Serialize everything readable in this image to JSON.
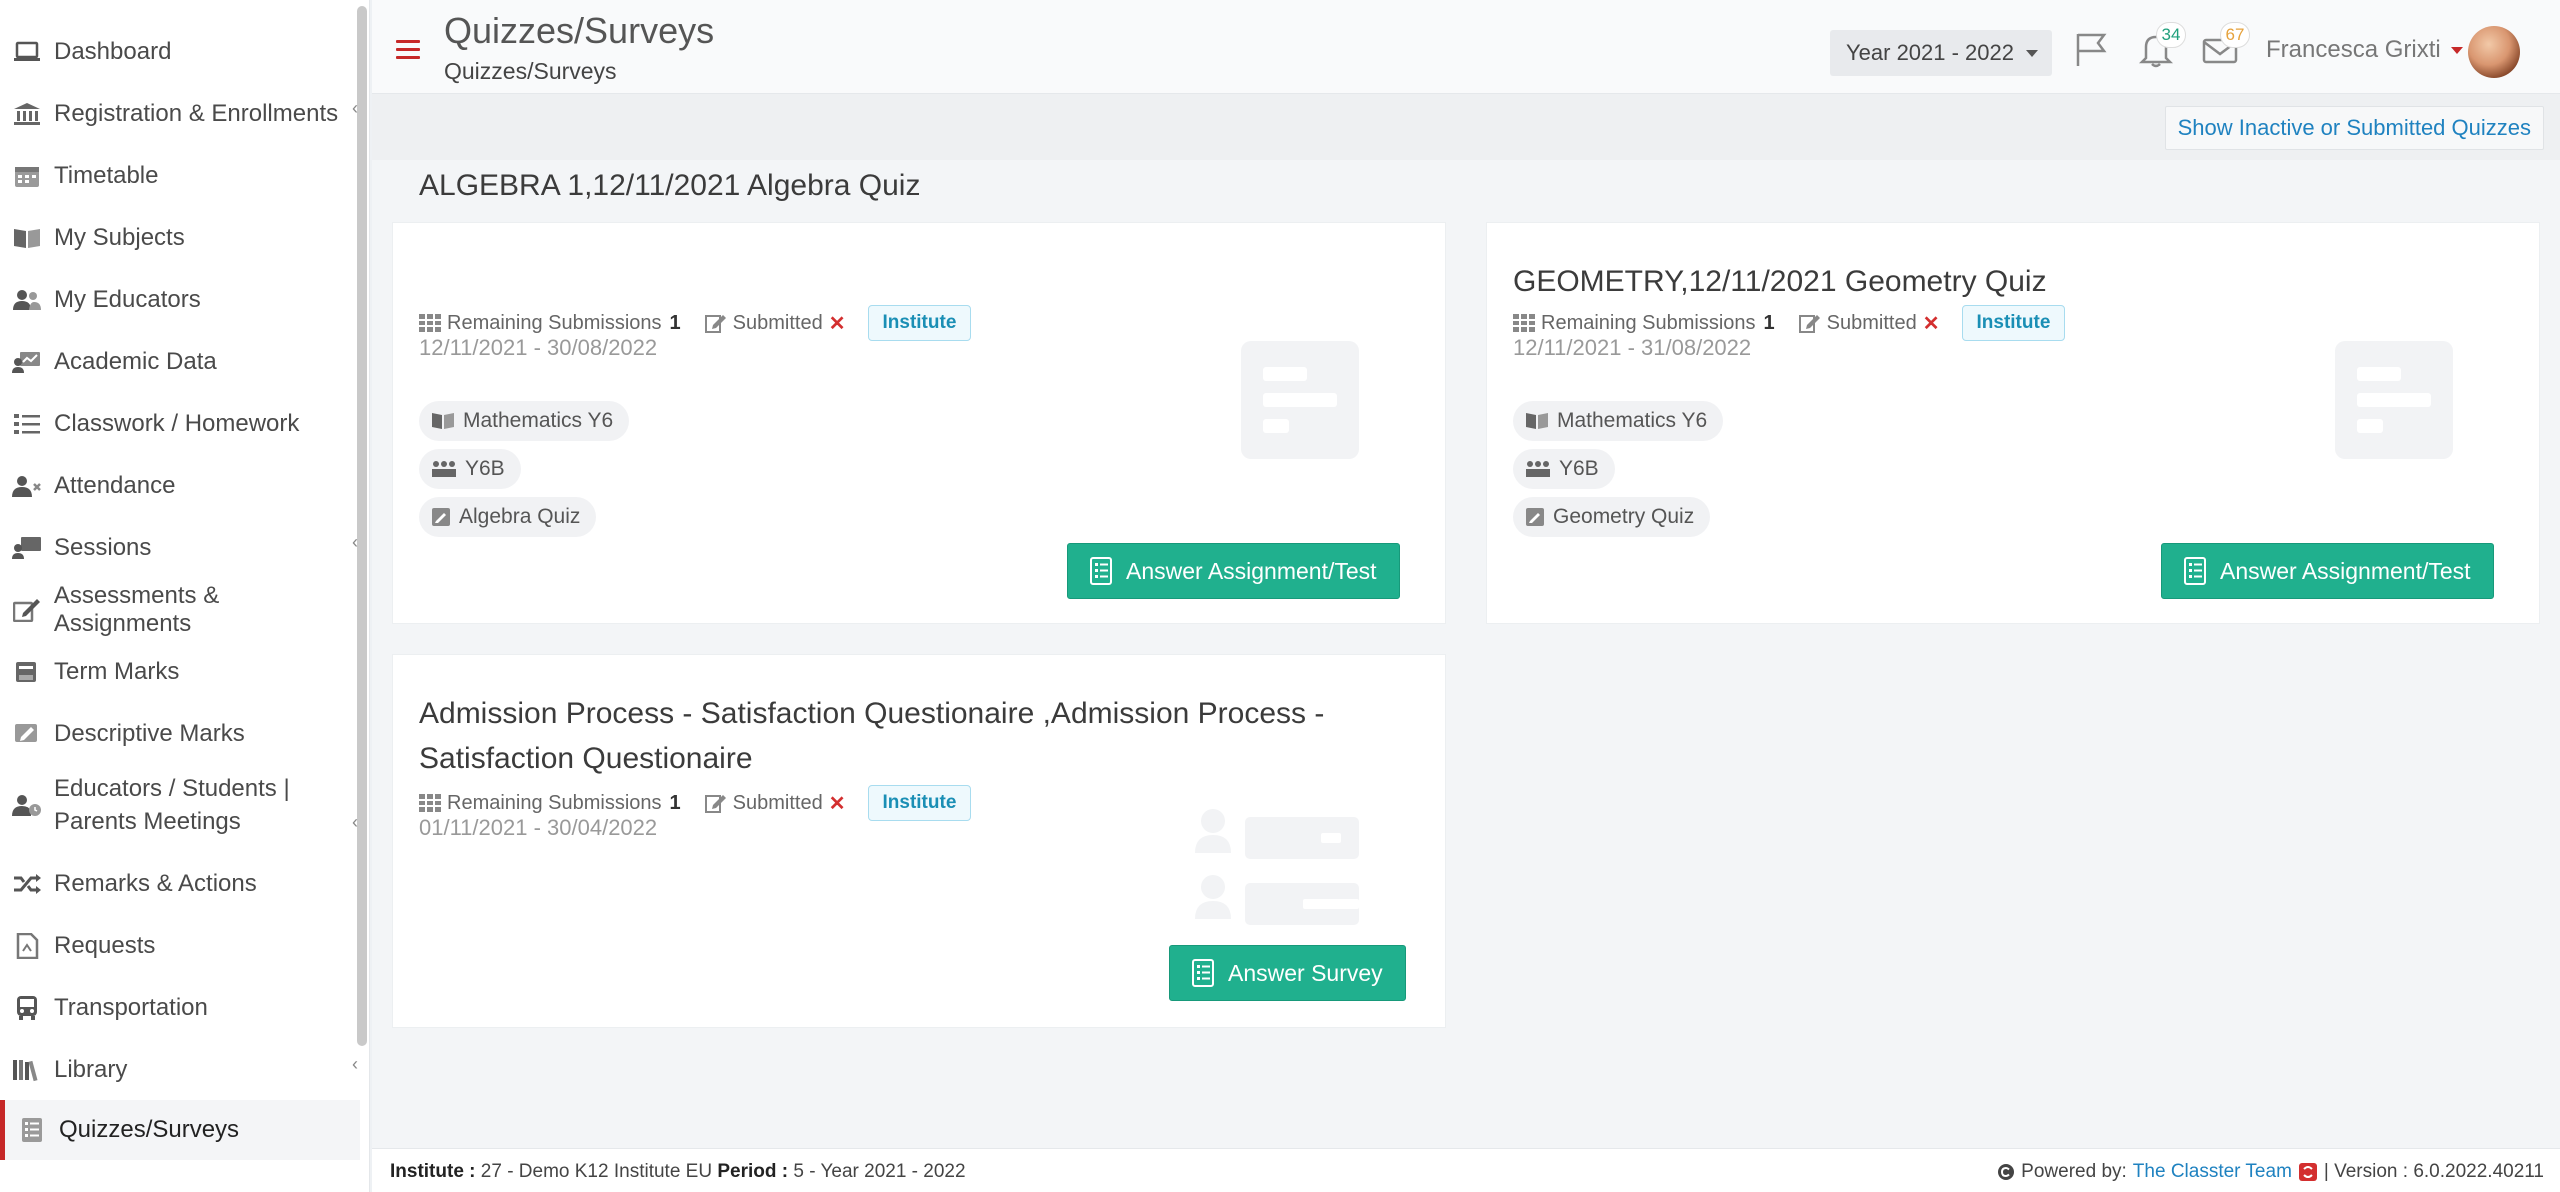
{
  "sidebar": {
    "items": [
      {
        "label": "Dashboard",
        "icon": "laptop-icon",
        "chevron": false
      },
      {
        "label": "Registration & Enrollments",
        "icon": "bank-icon",
        "chevron": true
      },
      {
        "label": "Timetable",
        "icon": "calendar-icon",
        "chevron": false
      },
      {
        "label": "My Subjects",
        "icon": "book-icon",
        "chevron": false
      },
      {
        "label": "My Educators",
        "icon": "users-icon",
        "chevron": false
      },
      {
        "label": "Academic Data",
        "icon": "chart-icon",
        "chevron": false
      },
      {
        "label": "Classwork / Homework",
        "icon": "checklist-icon",
        "chevron": false
      },
      {
        "label": "Attendance",
        "icon": "user-x-icon",
        "chevron": false
      },
      {
        "label": "Sessions",
        "icon": "presentation-icon",
        "chevron": true
      },
      {
        "label": "Assessments & Assignments",
        "icon": "edit-icon",
        "chevron": false
      },
      {
        "label": "Term Marks",
        "icon": "books-icon",
        "chevron": false
      },
      {
        "label": "Descriptive Marks",
        "icon": "comment-edit-icon",
        "chevron": false
      },
      {
        "label": "Educators / Students | Parents Meetings",
        "icon": "user-clock-icon",
        "chevron": true
      },
      {
        "label": "Remarks & Actions",
        "icon": "shuffle-icon",
        "chevron": false
      },
      {
        "label": "Requests",
        "icon": "document-icon",
        "chevron": false
      },
      {
        "label": "Transportation",
        "icon": "bus-icon",
        "chevron": false
      },
      {
        "label": "Library",
        "icon": "library-icon",
        "chevron": true
      },
      {
        "label": "Quizzes/Surveys",
        "icon": "quiz-icon",
        "chevron": false,
        "active": true
      }
    ]
  },
  "header": {
    "title": "Quizzes/Surveys",
    "subtitle": "Quizzes/Surveys",
    "year": "Year 2021 - 2022",
    "notifications_count": "34",
    "messages_count": "67",
    "user_name": "Francesca Grixti"
  },
  "toolbar": {
    "show_inactive_label": "Show Inactive or Submitted Quizzes"
  },
  "cards": [
    {
      "title": "ALGEBRA 1,12/11/2021 Algebra Quiz",
      "remaining_label": "Remaining Submissions",
      "remaining_value": "1",
      "submitted_label": "Submitted",
      "submitted_mark": "✕",
      "badge": "Institute",
      "dates": "12/11/2021 - 30/08/2022",
      "tags": [
        "Mathematics Y6",
        "Y6B",
        "Algebra Quiz"
      ],
      "button_label": "Answer Assignment/Test"
    },
    {
      "title": "GEOMETRY,12/11/2021 Geometry Quiz",
      "remaining_label": "Remaining Submissions",
      "remaining_value": "1",
      "submitted_label": "Submitted",
      "submitted_mark": "✕",
      "badge": "Institute",
      "dates": "12/11/2021 - 31/08/2022",
      "tags": [
        "Mathematics Y6",
        "Y6B",
        "Geometry Quiz"
      ],
      "button_label": "Answer Assignment/Test"
    },
    {
      "title_line1": "Admission Process - Satisfaction Questionaire ,Admission Process -",
      "title_line2": "Satisfaction Questionaire",
      "remaining_label": "Remaining Submissions",
      "remaining_value": "1",
      "submitted_label": "Submitted",
      "submitted_mark": "✕",
      "badge": "Institute",
      "dates": "01/11/2021 - 30/04/2022",
      "button_label": "Answer Survey"
    }
  ],
  "footer": {
    "institute_label": "Institute :",
    "institute_value": "27 - Demo K12 Institute EU",
    "period_label": "Period :",
    "period_value": "5 - Year 2021 - 2022",
    "powered_by": "Powered by:",
    "team": "The Classter Team",
    "version": "| Version : 6.0.2022.40211"
  },
  "colors": {
    "accent": "#c62828",
    "primary_button": "#20b08e",
    "link": "#1f82c0"
  }
}
